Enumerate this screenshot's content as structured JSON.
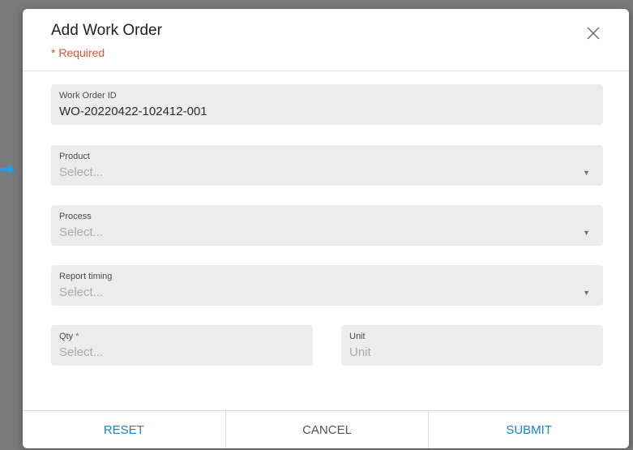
{
  "dialog": {
    "title": "Add Work Order",
    "required_note": "* Required"
  },
  "fields": {
    "work_order_id": {
      "label": "Work Order ID",
      "value": "WO-20220422-102412-001"
    },
    "product": {
      "label": "Product",
      "placeholder": "Select..."
    },
    "process": {
      "label": "Process",
      "placeholder": "Select..."
    },
    "report_timing": {
      "label": "Report timing",
      "placeholder": "Select..."
    },
    "qty": {
      "label": "Qty",
      "required_mark": "*",
      "placeholder": "Select..."
    },
    "unit": {
      "label": "Unit",
      "placeholder": "Unit"
    }
  },
  "footer": {
    "reset_label": "RESET",
    "cancel_label": "CANCEL",
    "submit_label": "SUBMIT"
  },
  "colors": {
    "accent": "#1a82d9",
    "required": "#e5502e",
    "field_bg": "#ececec",
    "pointer_arrow": "#1e9fe0"
  },
  "icons": {
    "close": "close-icon",
    "dropdown": "dropdown-caret-icon",
    "pointer": "arrow-right-icon"
  }
}
